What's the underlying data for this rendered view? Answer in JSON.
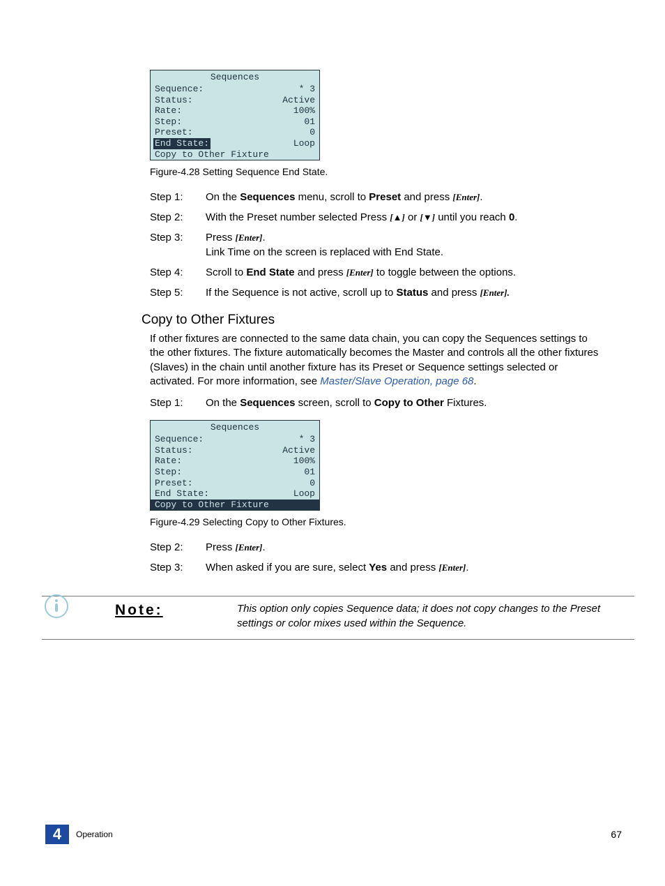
{
  "lcd1": {
    "title": "Sequences",
    "rows": [
      {
        "label": "Sequence:",
        "value": "* 3",
        "inverted": false
      },
      {
        "label": "Status:",
        "value": "Active",
        "inverted": false
      },
      {
        "label": "Rate:",
        "value": "100%",
        "inverted": false
      },
      {
        "label": "Step:",
        "value": "01",
        "inverted": false
      },
      {
        "label": " Preset:",
        "value": "0",
        "inverted": false
      },
      {
        "label": " End State:",
        "value": "Loop",
        "invertedLabel": true
      },
      {
        "label": "Copy to Other Fixture",
        "value": "",
        "inverted": false
      }
    ]
  },
  "fig1_caption": "Figure-4.28 Setting Sequence End State.",
  "stepsA": [
    {
      "label": "Step 1:",
      "pre": "On the ",
      "bold1": "Sequences",
      "mid": " menu, scroll to ",
      "bold2": "Preset",
      "post": " and press ",
      "key": "[Enter]",
      "after": "."
    },
    {
      "label": "Step 2:",
      "pre": "With the Preset number selected Press ",
      "key1": "[▲]",
      "mid": " or ",
      "key2": "[▼]",
      "post": " until you reach ",
      "bold": "0",
      "after": "."
    },
    {
      "label": "Step 3:",
      "pre": "Press ",
      "key": "[Enter]",
      "after": ".",
      "line2": "Link Time on the screen is replaced with End State."
    },
    {
      "label": "Step 4:",
      "pre": "Scroll to ",
      "bold": "End State",
      "mid": " and press ",
      "key": "[Enter]",
      "post": " to toggle between the options."
    },
    {
      "label": "Step 5:",
      "pre": "If the Sequence is not active, scroll up to ",
      "bold": "Status",
      "mid": " and press ",
      "key": "[Enter].",
      "post": ""
    }
  ],
  "section_heading": "Copy to Other Fixtures",
  "para1_a": "If other fixtures are connected to the same data chain, you can copy the Sequences settings to the other fixtures. The fixture automatically becomes the Master and controls all the other fixtures (Slaves) in the chain until another fixture has its Preset or Sequence settings selected or activated. For more information, see ",
  "para1_link": "Master/Slave Operation, page 68",
  "para1_b": ".",
  "stepB1": {
    "label": "Step 1:",
    "pre": "On the ",
    "bold1": "Sequences",
    "mid": " screen, scroll to ",
    "bold2": "Copy to Other",
    "post": " Fixtures."
  },
  "lcd2": {
    "title": "Sequences",
    "rows": [
      {
        "label": "Sequence:",
        "value": "* 3"
      },
      {
        "label": "Status:",
        "value": "Active"
      },
      {
        "label": "Rate:",
        "value": "100%"
      },
      {
        "label": "Step:",
        "value": "01"
      },
      {
        "label": " Preset:",
        "value": "0"
      },
      {
        "label": " End State:",
        "value": "Loop"
      },
      {
        "label": "Copy to Other Fixture",
        "value": "",
        "inverted": true
      }
    ]
  },
  "fig2_caption": "Figure-4.29 Selecting Copy to Other Fixtures.",
  "stepsC": [
    {
      "label": "Step 2:",
      "pre": "Press ",
      "key": "[Enter]",
      "after": "."
    },
    {
      "label": "Step 3:",
      "pre": "When asked if you are sure, select ",
      "bold": "Yes",
      "mid": " and press ",
      "key": "[Enter]",
      "after": "."
    }
  ],
  "note_label": "Note:",
  "note_text": "This option only copies Sequence data; it does not copy changes to the Preset settings or color mixes used within the Sequence.",
  "footer_tab": "4",
  "footer_section": "Operation",
  "footer_page": "67"
}
